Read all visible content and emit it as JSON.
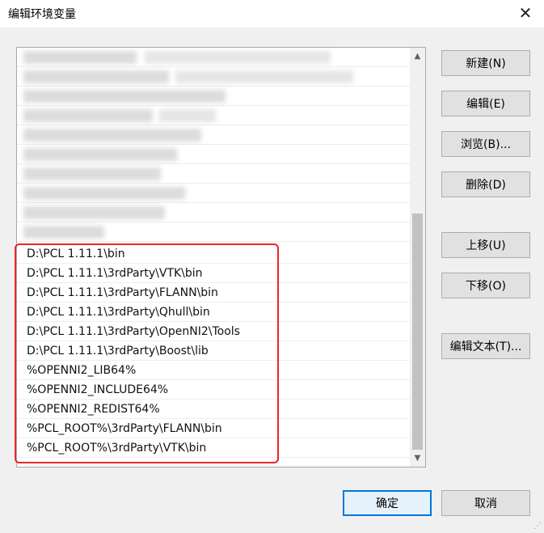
{
  "window": {
    "title": "编辑环境变量",
    "close_glyph": "✕"
  },
  "list": {
    "visible_paths": [
      "D:\\PCL 1.11.1\\bin",
      "D:\\PCL 1.11.1\\3rdParty\\VTK\\bin",
      "D:\\PCL 1.11.1\\3rdParty\\FLANN\\bin",
      "D:\\PCL 1.11.1\\3rdParty\\Qhull\\bin",
      "D:\\PCL 1.11.1\\3rdParty\\OpenNI2\\Tools",
      "D:\\PCL 1.11.1\\3rdParty\\Boost\\lib",
      "%OPENNI2_LIB64%",
      "%OPENNI2_INCLUDE64%",
      "%OPENNI2_REDIST64%",
      "%PCL_ROOT%\\3rdParty\\FLANN\\bin",
      "%PCL_ROOT%\\3rdParty\\VTK\\bin"
    ],
    "scroll_up_glyph": "▲",
    "scroll_down_glyph": "▼"
  },
  "buttons": {
    "new": "新建(N)",
    "edit": "编辑(E)",
    "browse": "浏览(B)...",
    "delete": "删除(D)",
    "move_up": "上移(U)",
    "move_down": "下移(O)",
    "edit_text": "编辑文本(T)...",
    "ok": "确定",
    "cancel": "取消"
  },
  "colors": {
    "highlight_border": "#e8262a",
    "primary_button_border": "#0078d7"
  }
}
